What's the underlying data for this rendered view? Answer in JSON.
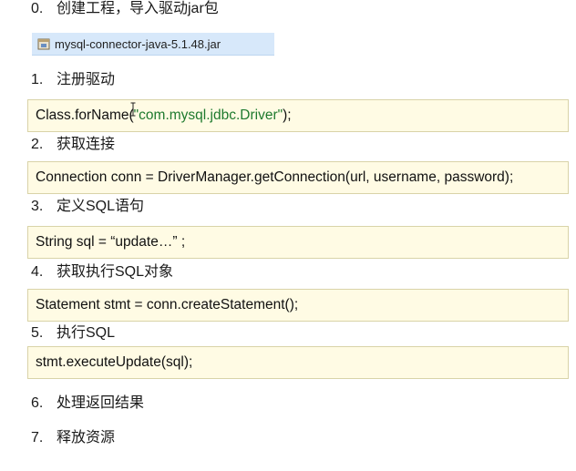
{
  "steps": [
    {
      "num": "0.",
      "text": "创建工程，导入驱动jar包"
    },
    {
      "num": "1.",
      "text": "注册驱动"
    },
    {
      "num": "2.",
      "text": "获取连接"
    },
    {
      "num": "3.",
      "text": "定义SQL语句"
    },
    {
      "num": "4.",
      "text": "获取执行SQL对象"
    },
    {
      "num": "5.",
      "text": "执行SQL"
    },
    {
      "num": "6.",
      "text": "处理返回结果"
    },
    {
      "num": "7.",
      "text": "释放资源"
    }
  ],
  "jar_file": {
    "name": "mysql-connector-java-5.1.48.jar",
    "icon": "jar-file-icon"
  },
  "code": {
    "register": {
      "prefix": "Class.forName(",
      "string": "\"com.mysql.jdbc.Driver\"",
      "suffix": ");"
    },
    "connection": "Connection conn = DriverManager.getConnection(url, username, password);",
    "sql": "String sql = “update…” ;",
    "statement": "Statement stmt = conn.createStatement();",
    "execute": "stmt.executeUpdate(sql);"
  },
  "colors": {
    "code_background": "#fffbe4",
    "code_border": "#d9d3a8",
    "string_literal": "#1e7a2e",
    "jar_highlight": "#d7e8fa"
  }
}
